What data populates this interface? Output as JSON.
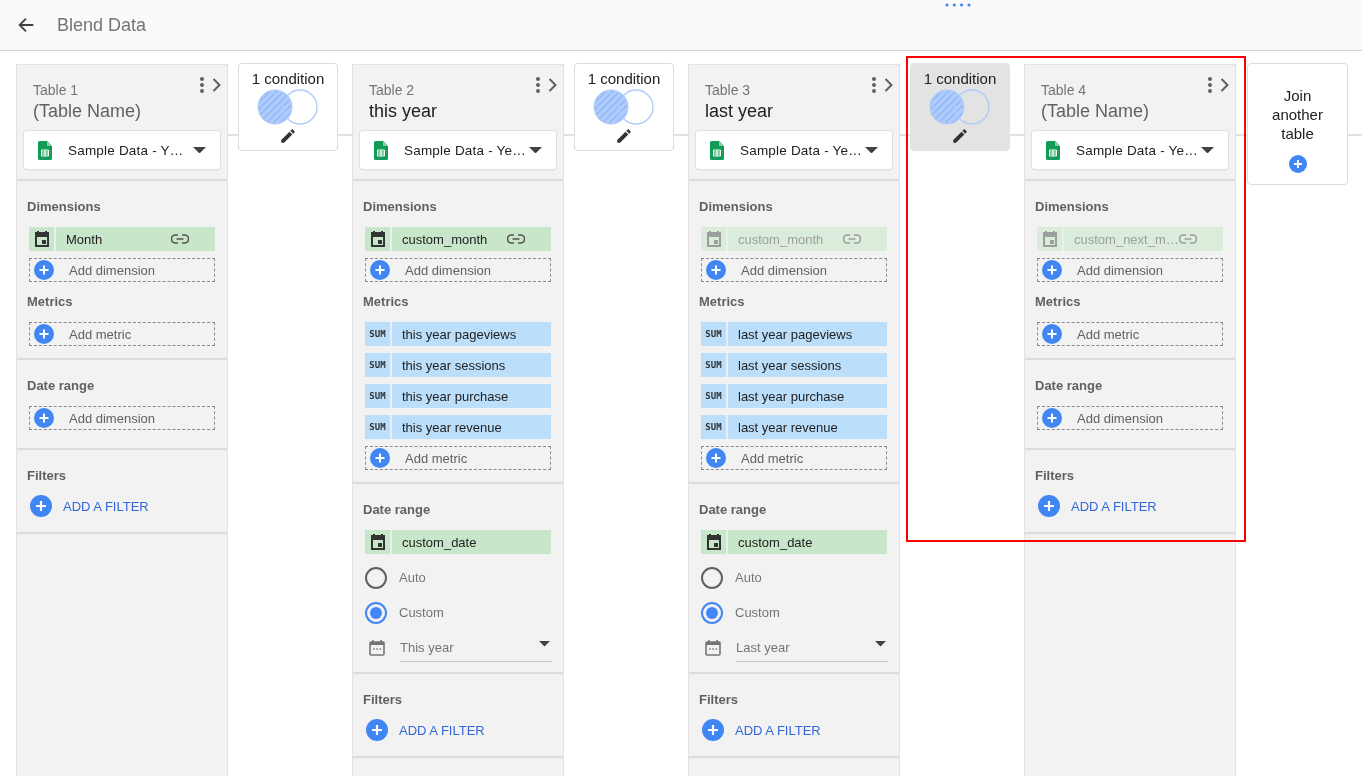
{
  "header": {
    "title": "Blend Data"
  },
  "tables": [
    {
      "label": "Table 1",
      "name_field": {
        "placeholder": "(Table Name)"
      },
      "source": "Sample Data - Y…",
      "highlighted": false,
      "dimensions": {
        "heading": "Dimensions",
        "fields": [
          {
            "name": "Month",
            "disabled": false
          }
        ],
        "add_label": "Add dimension"
      },
      "metrics": {
        "heading": "Metrics",
        "add_label": "Add metric"
      },
      "date_range": {
        "heading": "Date range",
        "add_label": "Add dimension"
      },
      "filters": {
        "heading": "Filters",
        "add_label": "ADD A FILTER"
      }
    },
    {
      "label": "Table 2",
      "join": {
        "label": "1 condition",
        "selected": false
      },
      "name_field": {
        "value": "this year"
      },
      "source": "Sample Data - Ye…",
      "highlighted": false,
      "dimensions": {
        "heading": "Dimensions",
        "fields": [
          {
            "name": "custom_month",
            "disabled": false
          }
        ],
        "add_label": "Add dimension"
      },
      "metrics": {
        "heading": "Metrics",
        "fields": [
          {
            "aggregation": "SUM",
            "name": "this year pageviews"
          },
          {
            "aggregation": "SUM",
            "name": "this year sessions"
          },
          {
            "aggregation": "SUM",
            "name": "this year purchase"
          },
          {
            "aggregation": "SUM",
            "name": "this year revenue"
          }
        ],
        "add_label": "Add metric"
      },
      "date_range": {
        "heading": "Date range",
        "fields": [
          {
            "name": "custom_date",
            "disabled": false
          }
        ],
        "options": [
          {
            "label": "Auto",
            "selected": false
          },
          {
            "label": "Custom",
            "selected": true
          }
        ],
        "period": {
          "value": "This year"
        }
      },
      "filters": {
        "heading": "Filters",
        "add_label": "ADD A FILTER"
      }
    },
    {
      "label": "Table 3",
      "join": {
        "label": "1 condition",
        "selected": false
      },
      "name_field": {
        "value": "last year"
      },
      "source": "Sample Data - Ye…",
      "highlighted": false,
      "dimensions": {
        "heading": "Dimensions",
        "fields": [
          {
            "name": "custom_month",
            "disabled": true
          }
        ],
        "add_label": "Add dimension"
      },
      "metrics": {
        "heading": "Metrics",
        "fields": [
          {
            "aggregation": "SUM",
            "name": "last year pageviews"
          },
          {
            "aggregation": "SUM",
            "name": "last year sessions"
          },
          {
            "aggregation": "SUM",
            "name": "last year purchase"
          },
          {
            "aggregation": "SUM",
            "name": "last year revenue"
          }
        ],
        "add_label": "Add metric"
      },
      "date_range": {
        "heading": "Date range",
        "fields": [
          {
            "name": "custom_date",
            "disabled": false
          }
        ],
        "options": [
          {
            "label": "Auto",
            "selected": false
          },
          {
            "label": "Custom",
            "selected": true
          }
        ],
        "period": {
          "value": "Last year"
        }
      },
      "filters": {
        "heading": "Filters",
        "add_label": "ADD A FILTER"
      }
    },
    {
      "label": "Table 4",
      "join": {
        "label": "1 condition",
        "selected": true
      },
      "name_field": {
        "placeholder": "(Table Name)"
      },
      "source": "Sample Data - Ye…",
      "highlighted": true,
      "dimensions": {
        "heading": "Dimensions",
        "fields": [
          {
            "name": "custom_next_m…",
            "disabled": true
          }
        ],
        "add_label": "Add dimension"
      },
      "metrics": {
        "heading": "Metrics",
        "add_label": "Add metric"
      },
      "date_range": {
        "heading": "Date range",
        "add_label": "Add dimension"
      },
      "filters": {
        "heading": "Filters",
        "add_label": "ADD A FILTER"
      }
    }
  ],
  "join_another": {
    "label": "Join another table"
  }
}
